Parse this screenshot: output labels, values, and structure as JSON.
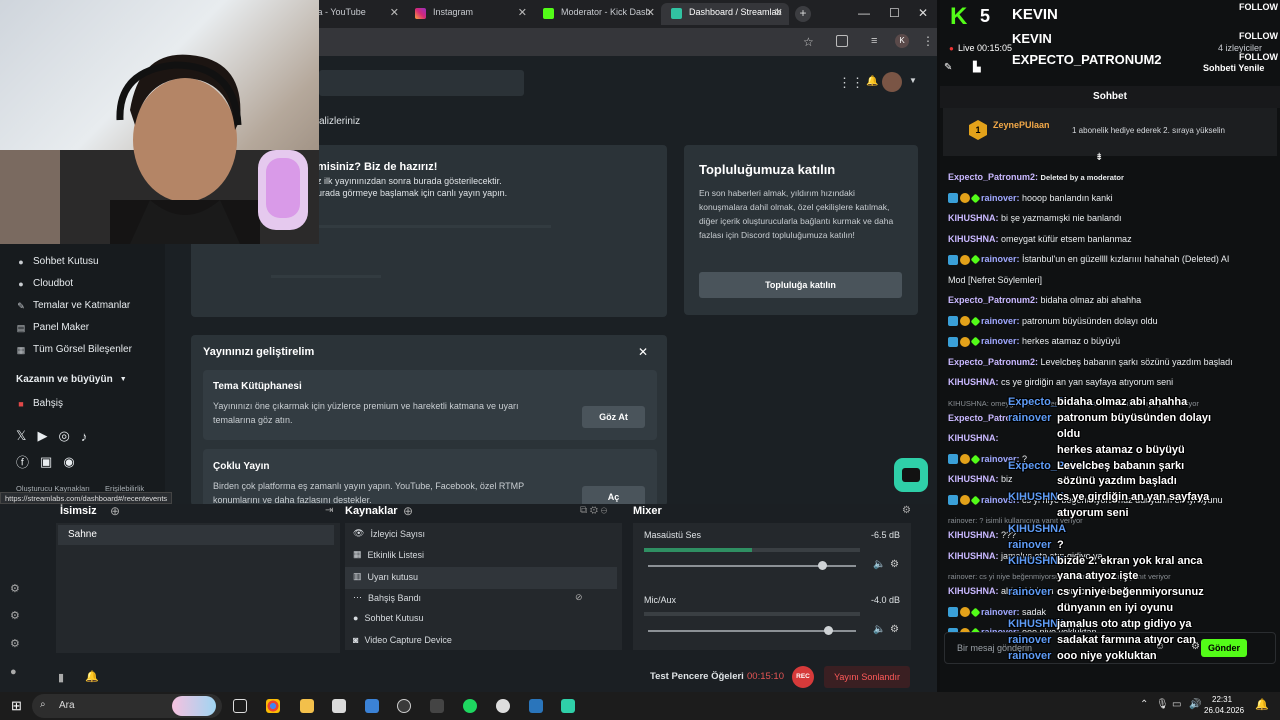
{
  "browser": {
    "tabs": [
      {
        "label": "lta - YouTube"
      },
      {
        "label": "Instagram"
      },
      {
        "label": "Moderator - Kick Dash"
      },
      {
        "label": "Dashboard / Streamlab"
      }
    ],
    "avatar_letter": "K"
  },
  "page": {
    "analytics_fragment": "alizleriniz",
    "ready_title": "misiniz? Biz de hazırız!",
    "ready_line1": "z ilk yayınınızdan sonra burada gösterilecektir.",
    "ready_line2": "urada görmeye başlamak için canlı yayın yapın.",
    "community_title": "Topluluğumuza katılın",
    "community_body": "En son haberleri almak, yıldırım hızındaki konuşmalara dahil olmak, özel çekilişlere katılmak, diğer içerik oluşturucularla bağlantı kurmak ve daha fazlası için Discord topluluğumuza katılın!",
    "community_button": "Topluluğa katılın",
    "improve_title": "Yayınınızı geliştirelim",
    "theme_title": "Tema Kütüphanesi",
    "theme_body": "Yayınınızı öne çıkarmak için yüzlerce premium ve hareketli katmana ve uyarı temalarına göz atın.",
    "theme_button": "Göz At",
    "multi_title": "Çoklu Yayın",
    "multi_body": "Birden çok platforma eş zamanlı yayın yapın. YouTube, Facebook, özel RTMP konumlarını ve daha fazlasını destekler.",
    "multi_button": "Aç",
    "url_hint": "https://streamlabs.com/dashboard#/recentevents"
  },
  "sidebar": {
    "items": [
      {
        "label": "Sohbet Kutusu",
        "icon": "chat-icon"
      },
      {
        "label": "Cloudbot",
        "icon": "bot-icon"
      },
      {
        "label": "Temalar ve Katmanlar",
        "icon": "brush-icon"
      },
      {
        "label": "Panel Maker",
        "icon": "panel-icon"
      },
      {
        "label": "Tüm Görsel Bileşenler",
        "icon": "grid-icon"
      }
    ],
    "earn_header": "Kazanın ve büyüyün",
    "donation": "Bahşiş",
    "footer_left": "Oluşturucu Kaynakları",
    "footer_right": "Erişilebilirlik"
  },
  "obs": {
    "scenes_title": "İsimsiz",
    "scene_item": "Sahne",
    "sources_title": "Kaynaklar",
    "sources": [
      "İzleyici Sayısı",
      "Etkinlik Listesi",
      "Uyarı kutusu",
      "Bahşiş Bandı",
      "Sohbet Kutusu",
      "Video Capture Device"
    ],
    "mixer_title": "Mixer",
    "mixer": [
      {
        "name": "Masaüstü Ses",
        "db": "-6.5 dB",
        "level": 0.85
      },
      {
        "name": "Mic/Aux",
        "db": "-4.0 dB",
        "level": 0.88
      }
    ],
    "test_label": "Test Pencere Öğeleri",
    "timer": "00:15:10",
    "rec": "REC",
    "end_button": "Yayını Sonlandır"
  },
  "kick": {
    "header_name": "KEVIN",
    "header_name2": "KEVIN",
    "header_name3": "EXPECTO_PATRONUM2",
    "follow": "FOLLOW",
    "live_label": "Live 00:15:05",
    "viewers": "4 izleyiciler",
    "refresh": "Sohbeti Yenile",
    "chat_title": "Sohbet",
    "gift_user": "ZeynePUlaan",
    "gift_text": "1 abonelik hediye ederek 2. sıraya yükselin",
    "input_placeholder": "Bir mesaj gönderin",
    "send": "Gönder"
  },
  "chat": [
    {
      "user": "Expecto_Patronum2:",
      "text": "Deleted by a moderator",
      "badges": false
    },
    {
      "user": "rainover:",
      "text": "hooop banlandın kanki",
      "badges": true
    },
    {
      "user": "KIHUSHNA:",
      "text": "bi şe yazmamışki nie banlandı",
      "badges": false
    },
    {
      "user": "KIHUSHNA:",
      "text": "omeygat küfür etsem banlanmaz",
      "badges": false
    },
    {
      "user": "rainover:",
      "text": "İstanbul'un en güzellll kızlarıııı hahahah (Deleted) AI",
      "badges": true
    },
    {
      "user": "",
      "text": "Mod [Nefret Söylemleri]",
      "badges": false
    },
    {
      "user": "Expecto_Patronum2:",
      "text": "bidaha olmaz abi ahahha",
      "badges": false
    },
    {
      "user": "rainover:",
      "text": "patronum büyüsünden dolayı oldu",
      "badges": true
    },
    {
      "user": "rainover:",
      "text": "herkes atamaz o büyüyü",
      "badges": true
    },
    {
      "user": "Expecto_Patronum2:",
      "text": "Levelcbeş babanın şarkı sözünü yazdım başladı",
      "badges": false
    },
    {
      "user": "KIHUSHNA:",
      "text": "cs ye girdiğin an yan sayfaya atıyorum seni",
      "badges": false
    },
    {
      "user": "",
      "text": "KIHUSHNA: omeygat küfür etsem banlanmaz isimli kullanıcıya yanıt veriyor",
      "badges": false
    },
    {
      "user": "Expecto_Patro",
      "text": "",
      "badges": false
    },
    {
      "user": "KIHUSHNA:",
      "text": "",
      "badges": false
    },
    {
      "user": "rainover:",
      "text": "?",
      "badges": true
    },
    {
      "user": "KIHUSHNA:",
      "text": "biz",
      "badges": false
    },
    {
      "user": "rainover:",
      "text": "cs yi niye beğenmiyorsunuz dünyanın en iyi oyunu",
      "badges": true
    },
    {
      "user": "",
      "text": "rainover: ? isimli kullanıcıya yanıt veriyor",
      "badges": false
    },
    {
      "user": "KIHUSHNA:",
      "text": "???",
      "badges": false
    },
    {
      "user": "KIHUSHNA:",
      "text": "jamalus oto atıp gidiyo ya",
      "badges": false
    },
    {
      "user": "",
      "text": "rainover: cs yi niye beğenmiyorsunuz isimli kullanıcıya yanıt veriyor",
      "badges": false
    },
    {
      "user": "KIHUSHNA:",
      "text": "abi yokluktan oynuyonuz benca",
      "badges": false
    },
    {
      "user": "rainover:",
      "text": "sadak",
      "badges": true
    },
    {
      "user": "rainover:",
      "text": "ooo niye yokluktan",
      "badges": true
    }
  ],
  "overlay": [
    {
      "name": "Expecto_Patro...",
      "lines": [
        "bidaha olmaz abi ahahha"
      ]
    },
    {
      "name": "rainover",
      "lines": [
        "patronum büyüsünden dolayı",
        "oldu"
      ]
    },
    {
      "name": "",
      "lines": [
        "herkes atamaz o büyüyü"
      ]
    },
    {
      "name": "Expecto_Patro",
      "lines": [
        "Levelcbeş babanın şarkı",
        "sözünü yazdım başladı"
      ]
    },
    {
      "name": "KIHUSHNA",
      "lines": [
        "cs ye girdiğin an yan sayfaya",
        "atıyorum seni"
      ]
    },
    {
      "name": "KIHUSHNA",
      "lines": [
        ""
      ]
    },
    {
      "name": "rainover",
      "lines": [
        "?"
      ]
    },
    {
      "name": "KIHUSHNA",
      "lines": [
        "bizde 2. ekran yok kral anca",
        "yana atıyoz işte"
      ]
    },
    {
      "name": "rainover",
      "lines": [
        "cs yi niye beğenmiyorsunuz",
        "dünyanın en iyi oyunu"
      ]
    },
    {
      "name": "KIHUSHNA",
      "lines": [
        "jamalus oto atıp gidiyo ya"
      ]
    },
    {
      "name": "rainover",
      "lines": [
        "sadakat farmına atıyor can"
      ]
    },
    {
      "name": "rainover",
      "lines": [
        "ooo niye yokluktan"
      ]
    }
  ],
  "taskbar": {
    "search": "Ara",
    "time": "22:31",
    "date": "26.04.2026"
  }
}
